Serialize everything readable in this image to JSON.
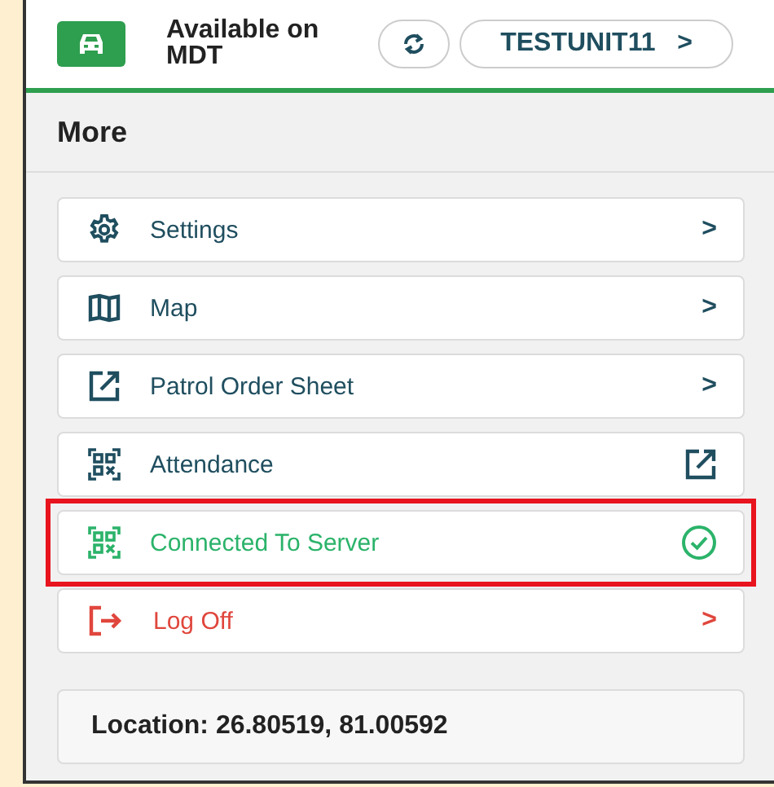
{
  "header": {
    "status": "Available on MDT",
    "unit": "TESTUNIT11",
    "unit_chevron": ">"
  },
  "section_title": "More",
  "items": [
    {
      "label": "Settings",
      "kind": "nav",
      "chevron": ">",
      "color": "#1f4e5f",
      "highlighted": false
    },
    {
      "label": "Map",
      "kind": "nav",
      "chevron": ">",
      "color": "#1f4e5f",
      "highlighted": false
    },
    {
      "label": "Patrol Order Sheet",
      "kind": "nav",
      "chevron": ">",
      "color": "#1f4e5f",
      "highlighted": false
    },
    {
      "label": "Attendance",
      "kind": "external",
      "color": "#1f4e5f",
      "highlighted": false
    },
    {
      "label": "Connected To Server",
      "kind": "status",
      "color": "#2bb36a",
      "highlighted": true
    },
    {
      "label": "Log Off",
      "kind": "nav",
      "chevron": ">",
      "color": "#e0463c",
      "highlighted": false
    }
  ],
  "location": "Location: 26.80519, 81.00592"
}
